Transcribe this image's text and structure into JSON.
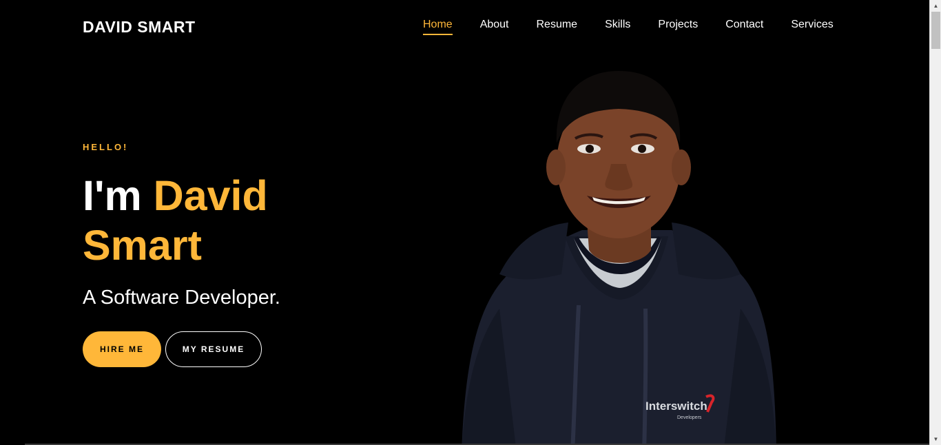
{
  "header": {
    "brand": "DAVID SMART",
    "nav": [
      {
        "label": "Home",
        "active": true
      },
      {
        "label": "About"
      },
      {
        "label": "Resume"
      },
      {
        "label": "Skills"
      },
      {
        "label": "Projects"
      },
      {
        "label": "Contact"
      },
      {
        "label": "Services"
      }
    ]
  },
  "hero": {
    "greeting": "HELLO!",
    "headline_prefix": "I'm",
    "headline_name": "David Smart",
    "subtitle": "A Software Developer.",
    "hire_button": "HIRE ME",
    "resume_button": "MY RESUME",
    "portrait": {
      "shirt_logo": "Interswitch",
      "shirt_logo_sub": "Developers"
    }
  },
  "colors": {
    "accent": "#ffb739",
    "background": "#000000",
    "text": "#ffffff"
  },
  "icons": {
    "scroll_up": "chevron-up-icon",
    "scroll_down": "chevron-down-icon"
  }
}
